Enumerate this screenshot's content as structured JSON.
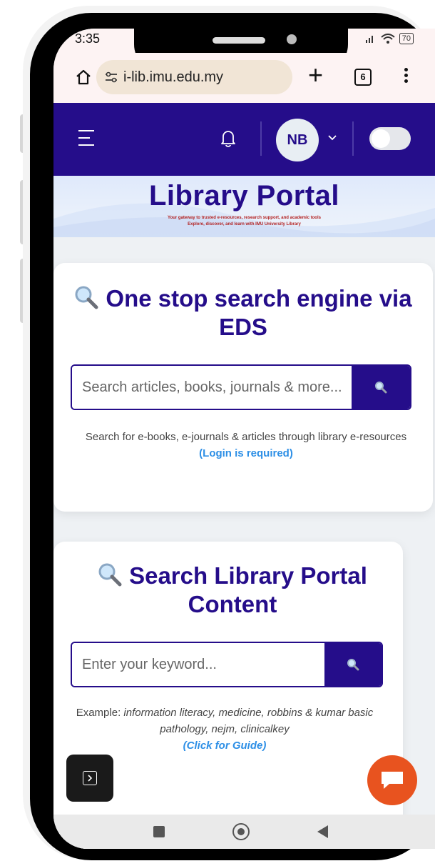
{
  "status": {
    "time": "3:35",
    "battery": "70"
  },
  "browser": {
    "url": "i-lib.imu.edu.my",
    "tab_count": "6"
  },
  "header": {
    "avatar_initials": "NB"
  },
  "banner": {
    "title": "Library Portal",
    "subtitle_line1": "Your gateway to trusted e-resources, research support, and academic tools",
    "subtitle_line2": "Explore, discover, and learn with IMU University Library"
  },
  "eds": {
    "title": "One stop search engine via EDS",
    "placeholder": "Search articles, books, journals & more...",
    "helper": "Search for e-books, e-journals & articles through library e-resources",
    "login_note": "(Login is required)"
  },
  "portal_search": {
    "title": "Search Library Portal Content",
    "placeholder": "Enter your keyword...",
    "example_label": "Example: ",
    "example_text": "information literacy, medicine, robbins & kumar basic pathology, nejm, clinicalkey",
    "guide_link": "(Click for Guide)"
  },
  "colors": {
    "brand": "#250d8a",
    "link": "#2d8fe6",
    "chat": "#e8531f"
  },
  "icons": [
    "home-icon",
    "tune-icon",
    "plus-icon",
    "tabs-icon",
    "more-icon",
    "menu-icon",
    "bell-icon",
    "chevron-down-icon",
    "search-icon",
    "magnifier-icon",
    "sidebar-toggle-icon",
    "chat-icon"
  ]
}
